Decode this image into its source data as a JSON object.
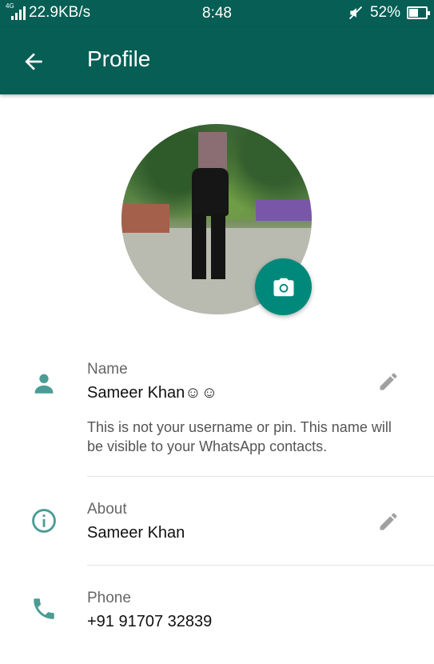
{
  "status_bar": {
    "network_type": "4G",
    "speed": "22.9KB/s",
    "time": "8:48",
    "battery_percent": "52%",
    "battery_level": 0.52
  },
  "toolbar": {
    "title": "Profile"
  },
  "profile": {
    "name_label": "Name",
    "name_value": "Sameer Khan☺☺",
    "name_hint": "This is not your username or pin. This name will be visible to your WhatsApp contacts.",
    "about_label": "About",
    "about_value": "Sameer Khan",
    "phone_label": "Phone",
    "phone_value": "+91 91707 32839"
  },
  "colors": {
    "primary": "#075e54",
    "accent": "#00897b",
    "icon_teal": "#4a9c94"
  },
  "icons": {
    "back": "arrow-back-icon",
    "camera": "camera-icon",
    "person": "person-icon",
    "info": "info-icon",
    "phone": "phone-icon",
    "edit": "pencil-icon"
  }
}
